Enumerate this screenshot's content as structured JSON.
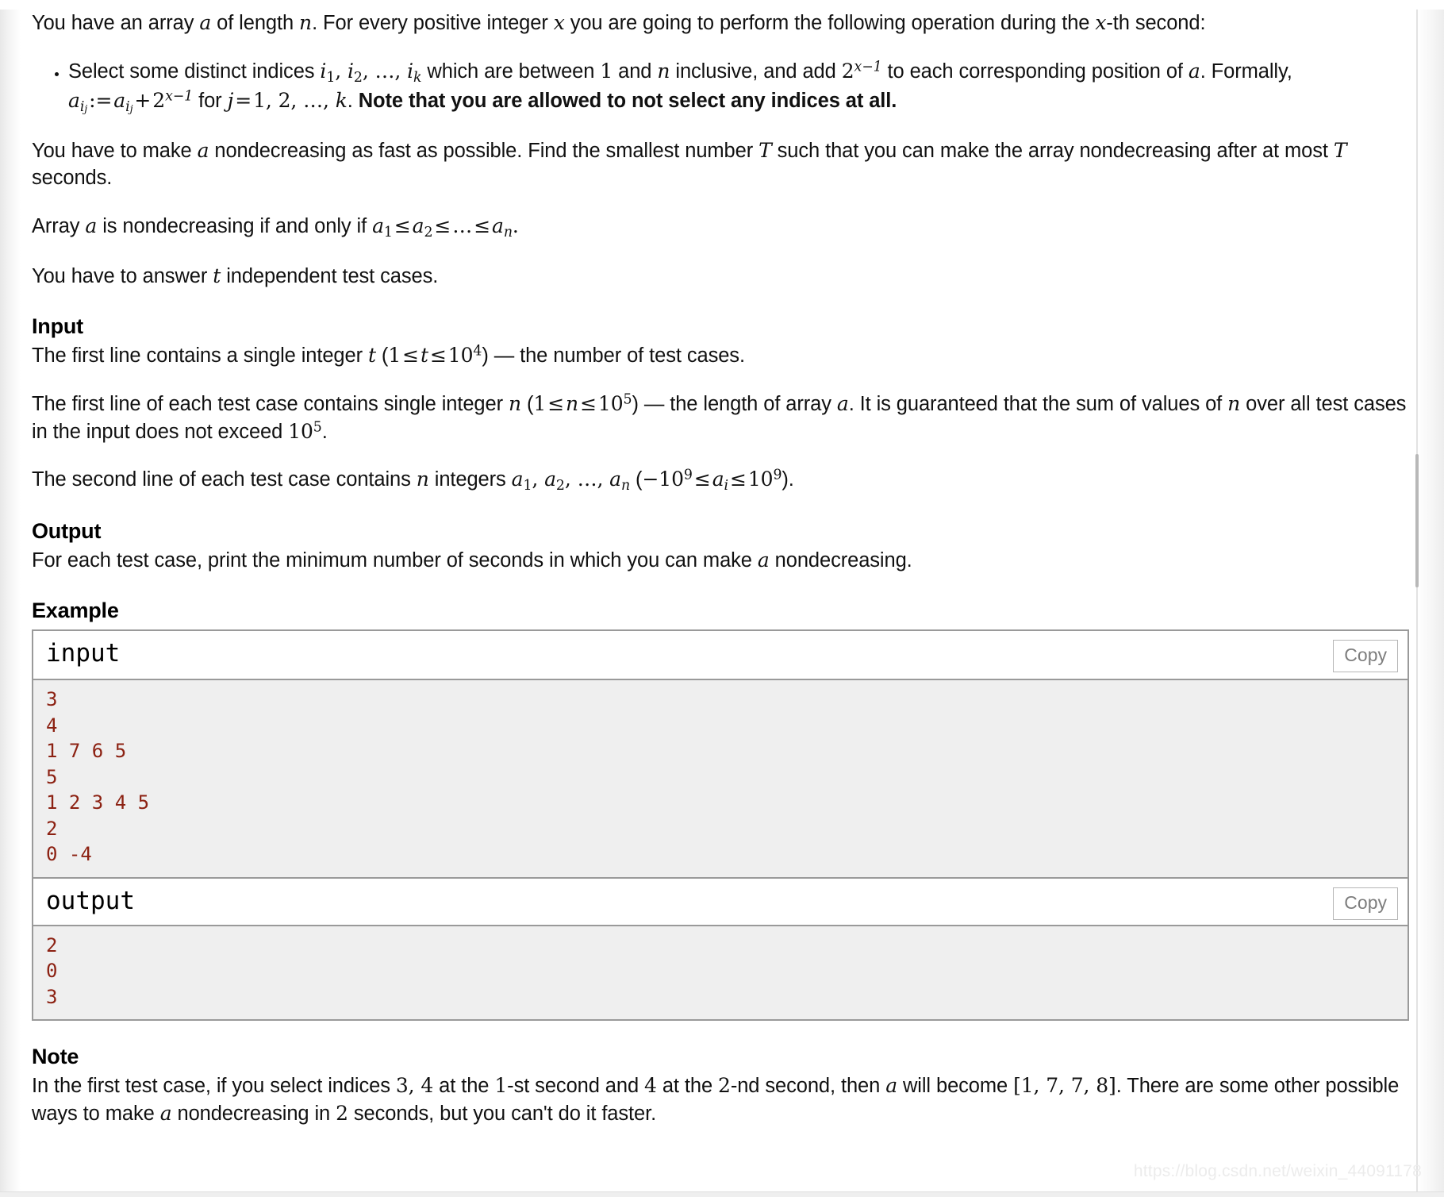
{
  "statement": {
    "intro_parts": {
      "a": "You have an array ",
      "var_a": "a",
      "b": " of length ",
      "var_n": "n",
      "c": ". For every positive integer ",
      "var_x": "x",
      "d": " you are going to perform the following operation during the ",
      "var_x2": "x",
      "e": "-th second:"
    },
    "bullet": {
      "p1": "Select some distinct indices ",
      "i1": "i",
      "i1sub": "1",
      "comma1": ", ",
      "i2": "i",
      "i2sub": "2",
      "comma2": ", ",
      "dots": "…",
      "comma3": ", ",
      "ik": "i",
      "iksub": "k",
      "p2": " which are between ",
      "one": "1",
      "p3": " and ",
      "n": "n",
      "p4": " inclusive, and add ",
      "two": "2",
      "pow": "x−1",
      "p5": " to each corresponding position of ",
      "a2": "a",
      "p6": ". Formally, ",
      "aij1": "a",
      "aij1sub": "i",
      "aij1subsub": "j",
      "assign": ":=",
      "aij2": "a",
      "aij2sub": "i",
      "aij2subsub": "j",
      "plus": "+",
      "two2": "2",
      "pow2": "x−1",
      "p7": " for ",
      "j": "j",
      "eq": "=",
      "list": "1, 2, …",
      "comma4": ", ",
      "k": "k",
      "p8": ". ",
      "bold": "Note that you are allowed to not select any indices at all."
    },
    "para2": {
      "p1": "You have to make ",
      "a": "a",
      "p2": " nondecreasing as fast as possible. Find the smallest number ",
      "T": "T",
      "p3": " such that you can make the array nondecreasing after at most ",
      "T2": "T",
      "p4": " seconds."
    },
    "para3": {
      "p1": "Array ",
      "a": "a",
      "p2": " is nondecreasing if and only if ",
      "a1": "a",
      "a1sub": "1",
      "le1": "≤",
      "a2": "a",
      "a2sub": "2",
      "le2": "≤",
      "dots": "…",
      "le3": "≤",
      "an": "a",
      "ansub": "n",
      "p3": "."
    },
    "para4": {
      "p1": "You have to answer ",
      "t": "t",
      "p2": " independent test cases."
    }
  },
  "input_section": {
    "heading": "Input",
    "p1": {
      "a": "The first line contains a single integer ",
      "t": "t",
      "b": " (",
      "one": "1",
      "le1": "≤",
      "t2": "t",
      "le2": "≤",
      "ten": "10",
      "exp": "4",
      "c": ") — the number of test cases."
    },
    "p2": {
      "a": "The first line of each test case contains single integer ",
      "n": "n",
      "b": " (",
      "one": "1",
      "le1": "≤",
      "n2": "n",
      "le2": "≤",
      "ten": "10",
      "exp": "5",
      "c": ") — the length of array ",
      "arr": "a",
      "d": ". It is guaranteed that the sum of values of ",
      "n3": "n",
      "e": " over all test cases in the input does not exceed ",
      "ten2": "10",
      "exp2": "5",
      "f": "."
    },
    "p3": {
      "a": "The second line of each test case contains ",
      "n": "n",
      "b": " integers ",
      "a1": "a",
      "a1sub": "1",
      "c1": ", ",
      "a2": "a",
      "a2sub": "2",
      "c2": ", ",
      "dots": "…",
      "c3": ", ",
      "an": "a",
      "ansub": "n",
      "c": " (",
      "neg": "−",
      "ten": "10",
      "exp": "9",
      "le1": "≤",
      "ai": "a",
      "aisub": "i",
      "le2": "≤",
      "ten2": "10",
      "exp2": "9",
      "d": ")."
    }
  },
  "output_section": {
    "heading": "Output",
    "p1": {
      "a": "For each test case, print the minimum number of seconds in which you can make ",
      "arr": "a",
      "b": " nondecreasing."
    }
  },
  "example_section": {
    "heading": "Example",
    "input_label": "input",
    "output_label": "output",
    "copy_label": "Copy",
    "input_data": "3\n4\n1 7 6 5\n5\n1 2 3 4 5\n2\n0 -4",
    "output_data": "2\n0\n3"
  },
  "note_section": {
    "heading": "Note",
    "p1": {
      "a": "In the first test case, if you select indices ",
      "three": "3",
      "cm": ", ",
      "four": "4",
      "b": " at the ",
      "one": "1",
      "c": "-st second and ",
      "four2": "4",
      "d": " at the ",
      "two": "2",
      "e": "-nd second, then ",
      "arr": "a",
      "f": " will become ",
      "arrval": "[1, 7, 7, 8]",
      "g": ". There are some other possible ways to make ",
      "arr2": "a",
      "h": " nondecreasing in ",
      "twosec": "2",
      "i": " seconds, but you can't do it faster."
    }
  },
  "watermark": "https://blog.csdn.net/weixin_44091178",
  "colors": {
    "sample_text": "#8c2112",
    "sample_bg": "#efefef",
    "border": "#9a9a9a",
    "copy_text": "#7d7d7d"
  }
}
